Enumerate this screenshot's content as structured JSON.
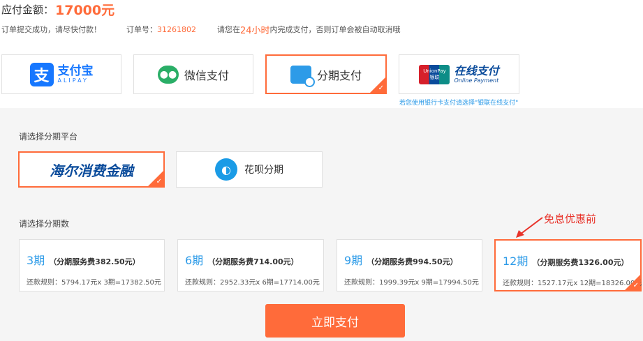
{
  "header": {
    "amount_label": "应付金额：",
    "amount_value": "17000元",
    "notice_success": "订单提交成功，请尽快付款！",
    "order_label": "订单号：",
    "order_number": "31261802",
    "deadline_prefix": "请您在",
    "deadline_hours": "24小时",
    "deadline_suffix": "内完成支付，否则订单会被自动取消哦"
  },
  "payment_methods": [
    {
      "name": "支付宝",
      "sub": "ALIPAY",
      "icon": "alipay-icon",
      "selected": false
    },
    {
      "name": "微信支付",
      "icon": "wechat-icon",
      "selected": false
    },
    {
      "name": "分期支付",
      "icon": "installment-icon",
      "selected": true
    },
    {
      "name": "在线支付",
      "sub": "Online Payment",
      "icon_text_top": "UnionPay",
      "icon_text_bottom": "银联",
      "icon": "unionpay-icon",
      "selected": false
    }
  ],
  "union_hint": "若您使用银行卡支付请选择\"银联在线支付\"",
  "platform_section": {
    "title": "请选择分期平台",
    "platforms": [
      {
        "name": "海尔消费金融",
        "icon": "haier-logo",
        "selected": true
      },
      {
        "name": "花呗分期",
        "icon": "huabei-icon",
        "selected": false
      }
    ]
  },
  "term_section": {
    "title": "请选择分期数",
    "terms": [
      {
        "term": "3期",
        "fee": "（分期服务费382.50元）",
        "rule": "还款规则：5794.17元x 3期=17382.50元",
        "selected": false
      },
      {
        "term": "6期",
        "fee": "（分期服务费714.00元）",
        "rule": "还款规则：2952.33元x 6期=17714.00元",
        "selected": false
      },
      {
        "term": "9期",
        "fee": "（分期服务费994.50元）",
        "rule": "还款规则：1999.39元x 9期=17994.50元",
        "selected": false
      },
      {
        "term": "12期",
        "fee": "（分期服务费1326.00元）",
        "rule": "还款规则：1527.17元x 12期=18326.00元",
        "selected": true
      }
    ]
  },
  "annotation": "免息优惠前",
  "submit_label": "立即支付",
  "colors": {
    "accent": "#ff6b3a",
    "link_blue": "#2d9be8",
    "alipay_blue": "#1677ff",
    "wechat_green": "#2aae67",
    "annotation_red": "#e8332a",
    "panel_bg": "#f5f5f5"
  }
}
